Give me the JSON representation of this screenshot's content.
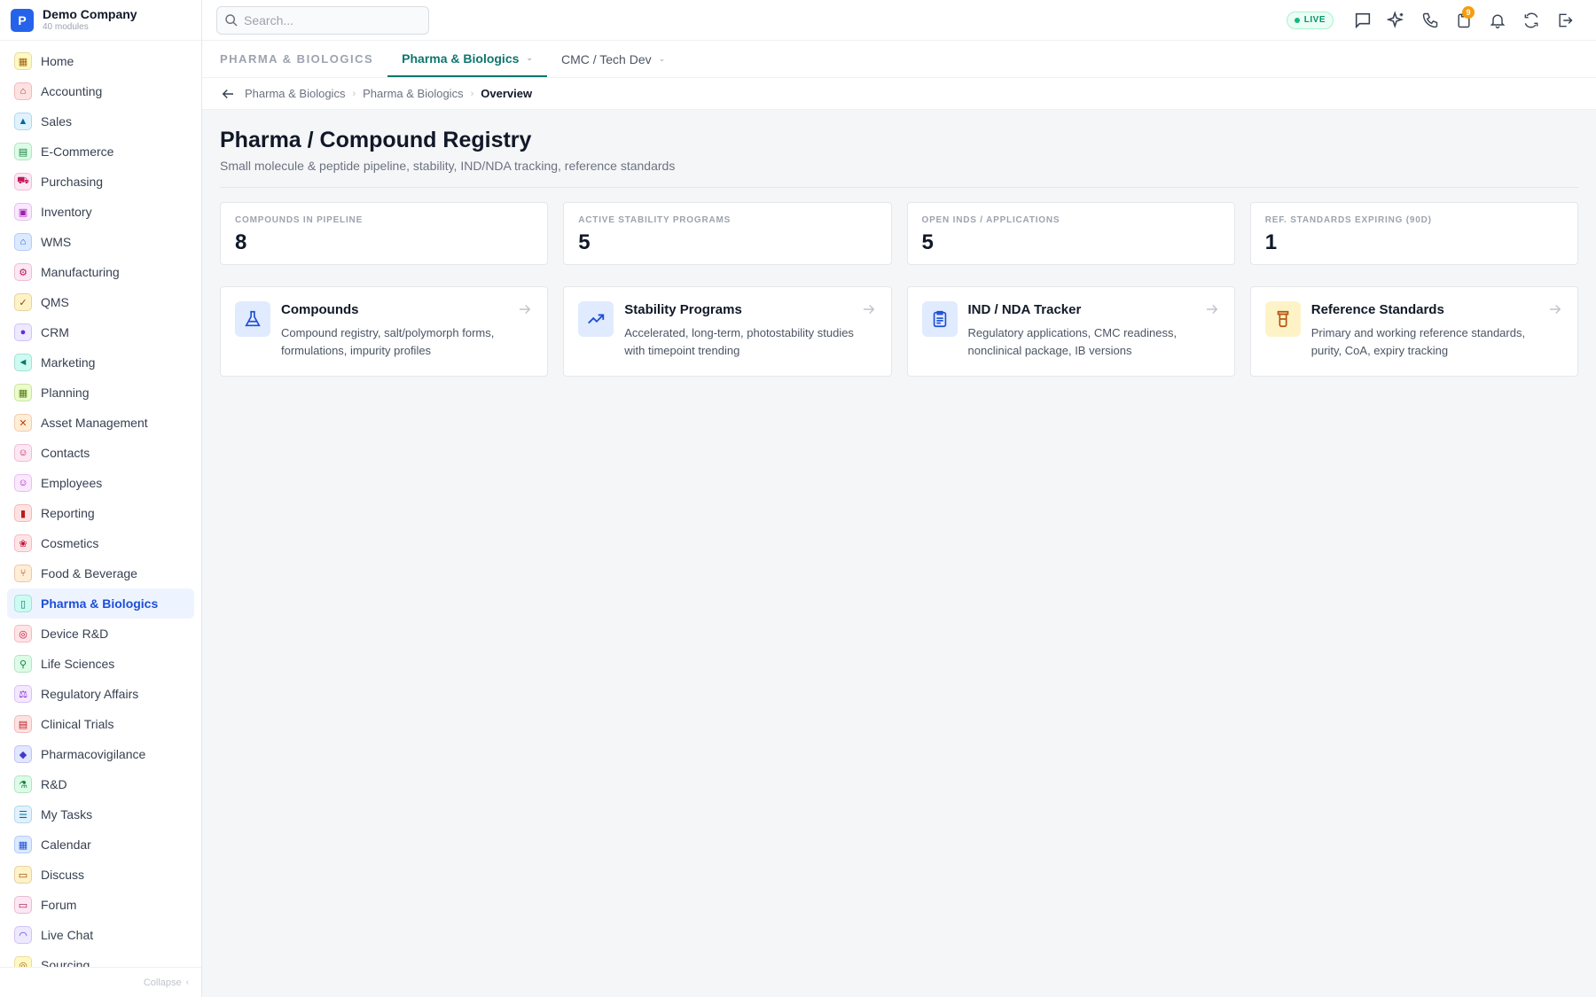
{
  "brand": {
    "logo_letter": "P",
    "name": "Demo Company",
    "subtitle": "40 modules"
  },
  "search": {
    "placeholder": "Search..."
  },
  "topbar": {
    "live_label": "LIVE",
    "notification_count": "9"
  },
  "sidebar": {
    "items": [
      {
        "label": "Home",
        "icon": "grid-icon",
        "glyph": "▦",
        "color": "#a16207",
        "bg": "#fef9c3"
      },
      {
        "label": "Accounting",
        "icon": "bank-icon",
        "glyph": "⌂",
        "color": "#b91c1c",
        "bg": "#fee2e2"
      },
      {
        "label": "Sales",
        "icon": "flask-icon",
        "glyph": "▲",
        "color": "#0369a1",
        "bg": "#e0f2fe"
      },
      {
        "label": "E-Commerce",
        "icon": "store-icon",
        "glyph": "▤",
        "color": "#15803d",
        "bg": "#dcfce7"
      },
      {
        "label": "Purchasing",
        "icon": "cart-icon",
        "glyph": "⛟",
        "color": "#be185d",
        "bg": "#fce7f3"
      },
      {
        "label": "Inventory",
        "icon": "box-icon",
        "glyph": "▣",
        "color": "#a21caf",
        "bg": "#fae8ff"
      },
      {
        "label": "WMS",
        "icon": "warehouse-icon",
        "glyph": "⌂",
        "color": "#1d4ed8",
        "bg": "#dbeafe"
      },
      {
        "label": "Manufacturing",
        "icon": "factory-icon",
        "glyph": "⚙",
        "color": "#be185d",
        "bg": "#fce7f3"
      },
      {
        "label": "QMS",
        "icon": "check-badge-icon",
        "glyph": "✓",
        "color": "#92400e",
        "bg": "#fef3c7"
      },
      {
        "label": "CRM",
        "icon": "users-icon",
        "glyph": "●",
        "color": "#6d28d9",
        "bg": "#ede9fe"
      },
      {
        "label": "Marketing",
        "icon": "megaphone-icon",
        "glyph": "◄",
        "color": "#0f766e",
        "bg": "#ccfbf1"
      },
      {
        "label": "Planning",
        "icon": "calendar-icon",
        "glyph": "▦",
        "color": "#4d7c0f",
        "bg": "#ecfccb"
      },
      {
        "label": "Asset Management",
        "icon": "tools-icon",
        "glyph": "✕",
        "color": "#c2410c",
        "bg": "#ffedd5"
      },
      {
        "label": "Contacts",
        "icon": "contact-icon",
        "glyph": "☺",
        "color": "#be185d",
        "bg": "#fce7f3"
      },
      {
        "label": "Employees",
        "icon": "employee-icon",
        "glyph": "☺",
        "color": "#a21caf",
        "bg": "#fae8ff"
      },
      {
        "label": "Reporting",
        "icon": "bar-chart-icon",
        "glyph": "▮",
        "color": "#b91c1c",
        "bg": "#fee2e2"
      },
      {
        "label": "Cosmetics",
        "icon": "lotus-icon",
        "glyph": "❀",
        "color": "#be123c",
        "bg": "#ffe4e6"
      },
      {
        "label": "Food & Beverage",
        "icon": "utensils-icon",
        "glyph": "⑂",
        "color": "#9a3412",
        "bg": "#ffedd5"
      },
      {
        "label": "Pharma & Biologics",
        "icon": "pill-bottle-icon",
        "glyph": "▯",
        "color": "#0f766e",
        "bg": "#ccfbf1",
        "active": true
      },
      {
        "label": "Device R&D",
        "icon": "chip-icon",
        "glyph": "◎",
        "color": "#be123c",
        "bg": "#ffe4e6"
      },
      {
        "label": "Life Sciences",
        "icon": "microscope-icon",
        "glyph": "⚲",
        "color": "#15803d",
        "bg": "#dcfce7"
      },
      {
        "label": "Regulatory Affairs",
        "icon": "gavel-icon",
        "glyph": "⚖",
        "color": "#7e22ce",
        "bg": "#f3e8ff"
      },
      {
        "label": "Clinical Trials",
        "icon": "clipboard-icon",
        "glyph": "▤",
        "color": "#b91c1c",
        "bg": "#fee2e2"
      },
      {
        "label": "Pharmacovigilance",
        "icon": "shield-icon",
        "glyph": "◆",
        "color": "#4338ca",
        "bg": "#e0e7ff"
      },
      {
        "label": "R&D",
        "icon": "beaker-icon",
        "glyph": "⚗",
        "color": "#15803d",
        "bg": "#dcfce7"
      },
      {
        "label": "My Tasks",
        "icon": "checklist-icon",
        "glyph": "☰",
        "color": "#0369a1",
        "bg": "#e0f2fe"
      },
      {
        "label": "Calendar",
        "icon": "calendar-icon",
        "glyph": "▦",
        "color": "#1d4ed8",
        "bg": "#dbeafe"
      },
      {
        "label": "Discuss",
        "icon": "chat-icon",
        "glyph": "▭",
        "color": "#92400e",
        "bg": "#fef3c7"
      },
      {
        "label": "Forum",
        "icon": "forum-icon",
        "glyph": "▭",
        "color": "#9d174d",
        "bg": "#fce7f3"
      },
      {
        "label": "Live Chat",
        "icon": "headset-icon",
        "glyph": "◠",
        "color": "#6d28d9",
        "bg": "#ede9fe"
      },
      {
        "label": "Sourcing",
        "icon": "sourcing-icon",
        "glyph": "◎",
        "color": "#a16207",
        "bg": "#fef9c3"
      }
    ],
    "collapse_label": "Collapse"
  },
  "tabs": {
    "section_label": "PHARMA & BIOLOGICS",
    "items": [
      {
        "label": "Pharma & Biologics",
        "active": true
      },
      {
        "label": "CMC / Tech Dev",
        "active": false
      }
    ]
  },
  "breadcrumb": {
    "items": [
      "Pharma & Biologics",
      "Pharma & Biologics"
    ],
    "current": "Overview"
  },
  "page": {
    "title": "Pharma / Compound Registry",
    "subtitle": "Small molecule & peptide pipeline, stability, IND/NDA tracking, reference standards"
  },
  "stats": [
    {
      "label": "COMPOUNDS IN PIPELINE",
      "value": "8"
    },
    {
      "label": "ACTIVE STABILITY PROGRAMS",
      "value": "5"
    },
    {
      "label": "OPEN INDS / APPLICATIONS",
      "value": "5"
    },
    {
      "label": "REF. STANDARDS EXPIRING (90D)",
      "value": "1"
    }
  ],
  "cards": [
    {
      "title": "Compounds",
      "desc": "Compound registry, salt/polymorph forms, formulations, impurity profiles",
      "icon": "flask-icon",
      "color": "#1d4ed8",
      "bg": "#e0ebff"
    },
    {
      "title": "Stability Programs",
      "desc": "Accelerated, long-term, photostability studies with timepoint trending",
      "icon": "trend-line-icon",
      "color": "#1d4ed8",
      "bg": "#e0ebff"
    },
    {
      "title": "IND / NDA Tracker",
      "desc": "Regulatory applications, CMC readiness, nonclinical package, IB versions",
      "icon": "clipboard-list-icon",
      "color": "#1d4ed8",
      "bg": "#e0ebff"
    },
    {
      "title": "Reference Standards",
      "desc": "Primary and working reference standards, purity, CoA, expiry tracking",
      "icon": "vial-icon",
      "color": "#b45309",
      "bg": "#fef3c7"
    }
  ]
}
